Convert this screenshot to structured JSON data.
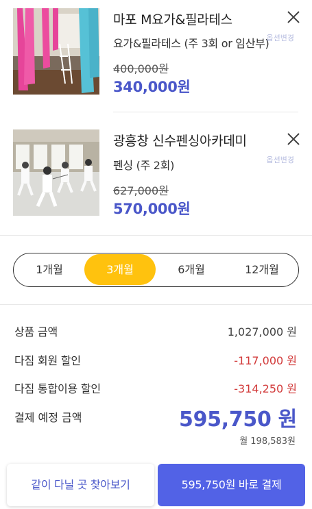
{
  "cart": {
    "items": [
      {
        "name": "마포 M요가&필라테스",
        "option": "요가&필라테스 (주 3회 or 임산부)",
        "change_label": "옵션변경",
        "original_price": "400,000원",
        "price": "340,000원"
      },
      {
        "name": "광흥창 신수펜싱아카데미",
        "option": "펜싱 (주 2회)",
        "change_label": "옵션변경",
        "original_price": "627,000원",
        "price": "570,000원"
      }
    ]
  },
  "period": {
    "options": [
      "1개월",
      "3개월",
      "6개월",
      "12개월"
    ],
    "selected": "3개월"
  },
  "summary": {
    "rows": [
      {
        "label": "상품 금액",
        "value": "1,027,000 원"
      },
      {
        "label": "다짐 회원 할인",
        "value": "-117,000 원"
      },
      {
        "label": "다짐 통합이용 할인",
        "value": "-314,250 원"
      }
    ],
    "total_label": "결제 예정 금액",
    "total_value": "595,750 원",
    "monthly": "월 198,583원"
  },
  "buttons": {
    "browse": "같이 다닐 곳 찾아보기",
    "pay": "595,750원 바로 결제"
  },
  "colors": {
    "accent": "#4a57c9",
    "pay_button": "#5262e6",
    "active_period": "#ffc20e",
    "discount": "#d23a3a"
  }
}
